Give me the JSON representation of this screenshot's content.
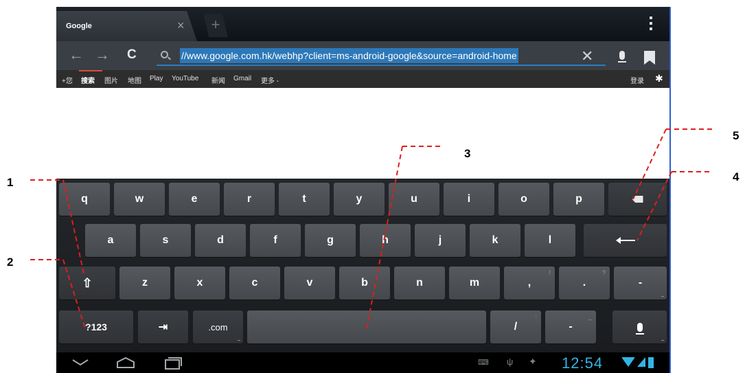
{
  "browser": {
    "tab_title": "Google",
    "tab_close": "×",
    "new_tab": "+",
    "back": "←",
    "forward": "→",
    "reload": "C",
    "url": "//www.google.com.hk/webhp?client=ms-android-google&source=android-home",
    "clear": "✕",
    "icons": [
      "search-icon",
      "mic-icon",
      "bookmark-icon",
      "menu-icon"
    ]
  },
  "google_bar": {
    "items": [
      "+您",
      "搜索",
      "图片",
      "地图",
      "Play",
      "YouTube",
      "新闻",
      "Gmail",
      "更多 -"
    ],
    "active_index": 1,
    "login": "登录",
    "settings": "✱",
    "accent": "#dd4b39"
  },
  "keyboard": {
    "row1": [
      "q",
      "w",
      "e",
      "r",
      "t",
      "y",
      "u",
      "i",
      "o",
      "p"
    ],
    "row2": [
      "a",
      "s",
      "d",
      "f",
      "g",
      "h",
      "j",
      "k",
      "l"
    ],
    "row3": [
      "z",
      "x",
      "c",
      "v",
      "b",
      "n",
      "m",
      ",",
      "."
    ],
    "row3_hints": [
      "!",
      "?"
    ],
    "shift": "⇧",
    "dash": "-",
    "symbols": "?123",
    "tab": "⇥",
    "dotcom": ".com",
    "slash": "/",
    "slash_hint": ":",
    "dash2": "-",
    "dash2_hint": "_"
  },
  "system_bar": {
    "clock": "12:54",
    "accent": "#33b5e5",
    "icons": [
      "back-nav-icon",
      "home-icon",
      "recent-apps-icon",
      "keyboard-icon",
      "usb-icon",
      "android-debug-icon",
      "wifi-icon",
      "signal-icon",
      "battery-icon"
    ]
  },
  "callouts": [
    "1",
    "2",
    "3",
    "4",
    "5"
  ]
}
